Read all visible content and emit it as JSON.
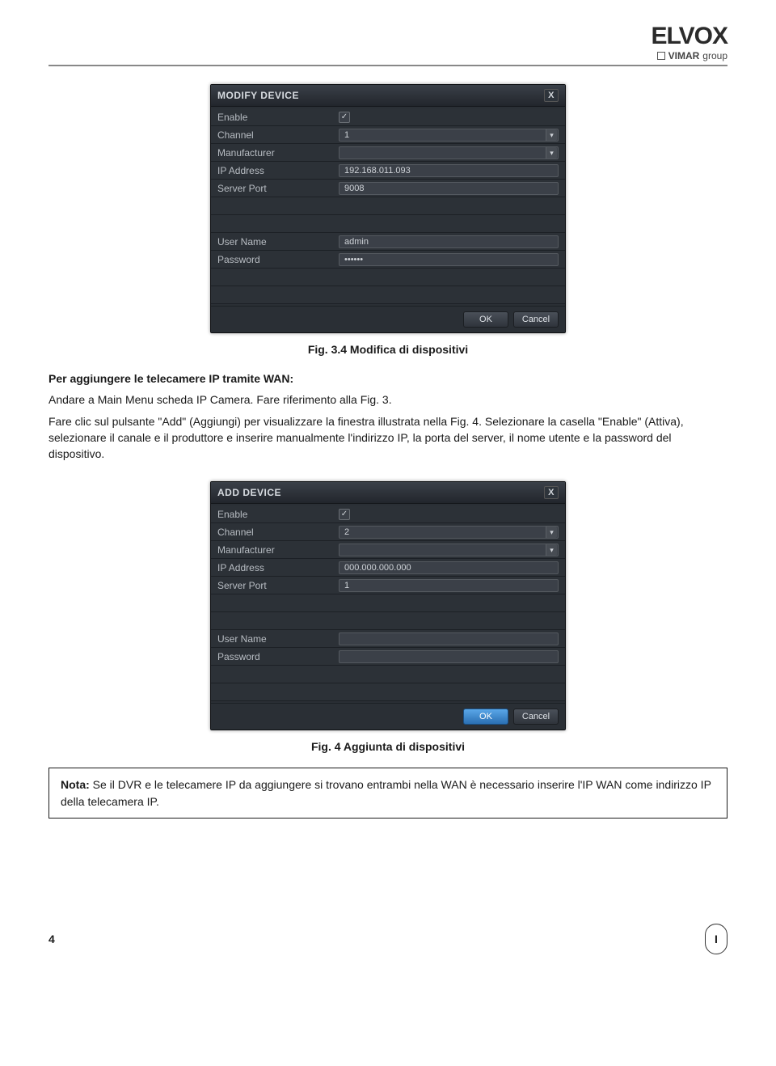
{
  "logo": {
    "main": "ELVOX",
    "sub_brand": "VIMAR",
    "sub_suffix": "group"
  },
  "dialog1": {
    "title": "MODIFY DEVICE",
    "close": "X",
    "rows": {
      "enable": {
        "label": "Enable",
        "checked": "✓"
      },
      "channel": {
        "label": "Channel",
        "value": "1"
      },
      "manufacturer": {
        "label": "Manufacturer",
        "value": ""
      },
      "ip": {
        "label": "IP Address",
        "value": "192.168.011.093"
      },
      "port": {
        "label": "Server Port",
        "value": "9008"
      },
      "user": {
        "label": "User Name",
        "value": "admin"
      },
      "password": {
        "label": "Password",
        "value": "••••••"
      }
    },
    "buttons": {
      "ok": "OK",
      "cancel": "Cancel"
    }
  },
  "caption1": "Fig. 3.4 Modifica di dispositivi",
  "paragraphs": {
    "p1_bold": "Per aggiungere le telecamere IP tramite WAN:",
    "p2": "Andare a Main Menu scheda IP Camera. Fare riferimento alla Fig. 3.",
    "p3": "Fare clic sul pulsante \"Add\" (Aggiungi) per visualizzare la finestra illustrata nella Fig. 4. Selezionare la casella \"Enable\" (Attiva), selezionare il canale e il produttore e inserire manualmente l'indirizzo IP, la porta del server, il nome utente e la password del dispositivo."
  },
  "dialog2": {
    "title": "ADD DEVICE",
    "close": "X",
    "rows": {
      "enable": {
        "label": "Enable",
        "checked": "✓"
      },
      "channel": {
        "label": "Channel",
        "value": "2"
      },
      "manufacturer": {
        "label": "Manufacturer",
        "value": ""
      },
      "ip": {
        "label": "IP Address",
        "value": "000.000.000.000"
      },
      "port": {
        "label": "Server Port",
        "value": "1"
      },
      "user": {
        "label": "User Name",
        "value": ""
      },
      "password": {
        "label": "Password",
        "value": ""
      }
    },
    "buttons": {
      "ok": "OK",
      "cancel": "Cancel"
    }
  },
  "caption2": "Fig. 4 Aggiunta di dispositivi",
  "note": {
    "prefix": "Nota:",
    "text": " Se il DVR e le telecamere IP da aggiungere si trovano entrambi nella WAN è necessario inserire l'IP WAN come indirizzo IP della telecamera IP."
  },
  "footer": {
    "page_left": "4",
    "page_right": "I"
  }
}
